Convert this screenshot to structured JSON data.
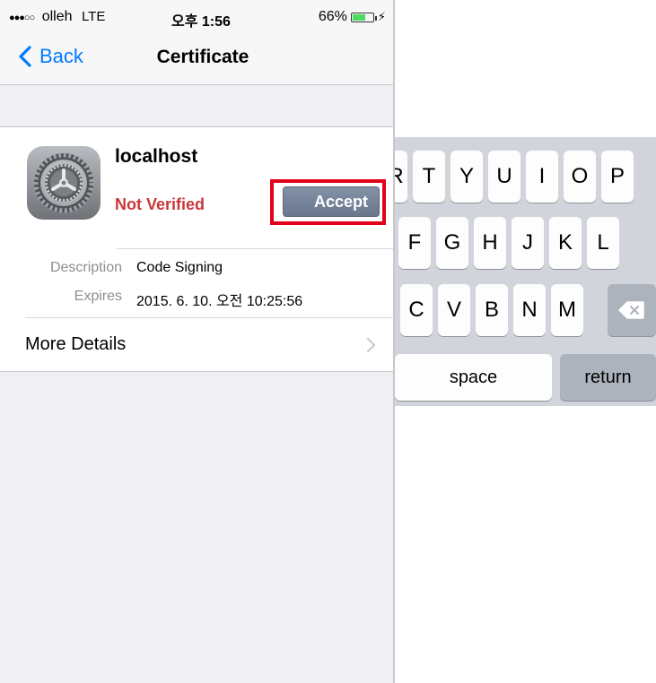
{
  "status_bar": {
    "carrier": "olleh",
    "network": "LTE",
    "time": "오후 1:56",
    "battery_text": "66%",
    "battery_level": 0.66,
    "signal_bars": 3
  },
  "nav": {
    "back_label": "Back",
    "title": "Certificate"
  },
  "certificate": {
    "name": "localhost",
    "status": "Not Verified",
    "status_color": "#c9383b",
    "accept_label": "Accept",
    "details": [
      {
        "label": "Description",
        "value": "Code Signing"
      },
      {
        "label": "Expires",
        "value": "2015. 6. 10. 오전 10:25:56"
      }
    ],
    "more_details_label": "More Details"
  },
  "keyboard": {
    "row1": [
      "R",
      "T",
      "Y",
      "U",
      "I",
      "O",
      "P"
    ],
    "row2": [
      "F",
      "G",
      "H",
      "J",
      "K",
      "L"
    ],
    "row3": [
      "C",
      "V",
      "B",
      "N",
      "M"
    ],
    "space_label": "space",
    "return_label": "return"
  },
  "colors": {
    "accent": "#007aff",
    "highlight_box": "#e2001a",
    "accept_button": "#7482a0"
  }
}
